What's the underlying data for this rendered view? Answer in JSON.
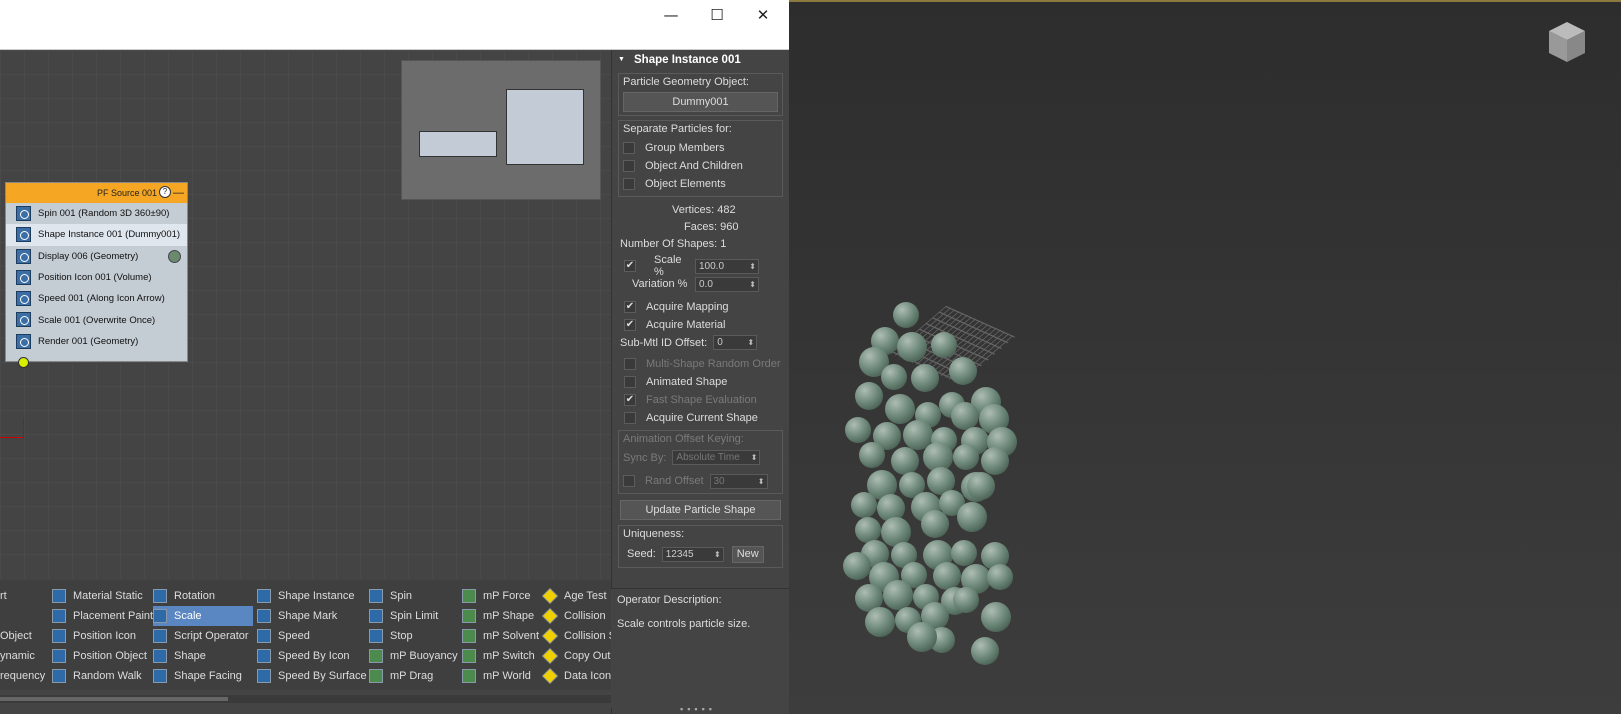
{
  "window": {
    "minimize_glyph": "—",
    "maximize_glyph": "☐",
    "close_glyph": "✕"
  },
  "node": {
    "title": "PF Source 001",
    "operators": [
      {
        "label": "Spin 001 (Random 3D 360±90)",
        "icon": "spin-icon"
      },
      {
        "label": "Shape Instance 001 (Dummy001)",
        "icon": "shape-instance-icon",
        "selected": true
      },
      {
        "label": "Display 006 (Geometry)",
        "icon": "display-icon",
        "dot_color": "#6b8a6b"
      },
      {
        "label": "Position Icon 001 (Volume)",
        "icon": "position-icon"
      },
      {
        "label": "Speed 001 (Along Icon Arrow)",
        "icon": "speed-icon"
      },
      {
        "label": "Scale 001 (Overwrite Once)",
        "icon": "scale-icon"
      },
      {
        "label": "Render 001 (Geometry)",
        "icon": "render-icon"
      }
    ]
  },
  "depot": {
    "columns": [
      [
        "rt",
        "Object",
        "ynamic",
        "requency"
      ],
      [
        "Material Static",
        "Placement Paint",
        "Position Icon",
        "Position Object",
        "Random Walk"
      ],
      [
        "Rotation",
        "Scale",
        "Script Operator",
        "Shape",
        "Shape Facing"
      ],
      [
        "Shape Instance",
        "Shape Mark",
        "Speed",
        "Speed By Icon",
        "Speed By Surface"
      ],
      [
        "Spin",
        "Spin Limit",
        "Stop",
        "mP Buoyancy",
        "mP Drag"
      ],
      [
        "mP Force",
        "mP Shape",
        "mP Solvent",
        "mP Switch",
        "mP World"
      ],
      [
        "Age Test",
        "Collision",
        "Collision S",
        "Copy Out",
        "Data Icon"
      ]
    ],
    "selected": "Scale"
  },
  "panel": {
    "rollout_title": "Shape Instance 001",
    "geometry_group_title": "Particle Geometry Object:",
    "geometry_button": "Dummy001",
    "separate_group_title": "Separate Particles for:",
    "separate_options": [
      "Group Members",
      "Object And Children",
      "Object Elements"
    ],
    "vertices_label": "Vertices:",
    "vertices_value": "482",
    "faces_label": "Faces:",
    "faces_value": "960",
    "num_shapes_label": "Number Of Shapes:",
    "num_shapes_value": "1",
    "scale_label": "Scale %",
    "scale_value": "100.0",
    "variation_label": "Variation %",
    "variation_value": "0.0",
    "acquire_mapping": "Acquire Mapping",
    "acquire_material": "Acquire Material",
    "submtl_label": "Sub-Mtl ID Offset:",
    "submtl_value": "0",
    "multi_shape": "Multi-Shape Random Order",
    "animated_shape": "Animated Shape",
    "fast_shape": "Fast Shape Evaluation",
    "acquire_current": "Acquire Current Shape",
    "anim_group_title": "Animation Offset Keying:",
    "sync_label": "Sync By:",
    "sync_value": "Absolute Time",
    "rand_offset_label": "Rand Offset",
    "rand_offset_value": "30",
    "update_button": "Update Particle Shape",
    "uniqueness_title": "Uniqueness:",
    "seed_label": "Seed:",
    "seed_value": "12345",
    "new_button": "New"
  },
  "description": {
    "title": "Operator Description:",
    "text": "Scale controls particle size."
  }
}
